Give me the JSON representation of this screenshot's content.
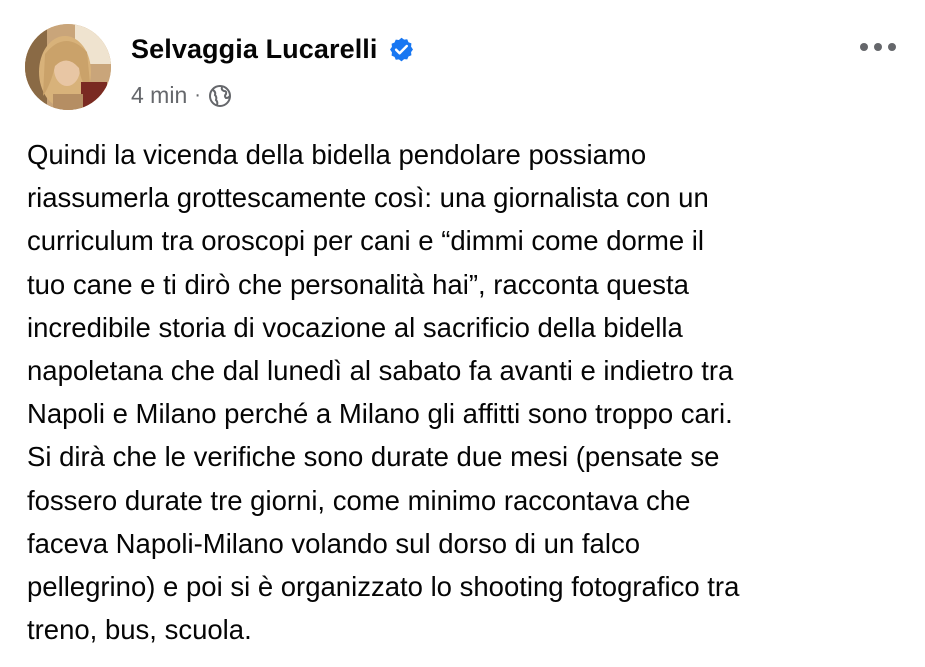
{
  "post": {
    "author_name": "Selvaggia Lucarelli",
    "verified": true,
    "timestamp": "4 min",
    "separator": "·",
    "audience_icon": "globe-icon",
    "more_icon": "more-options-icon",
    "text_lines": [
      "Quindi la vicenda della bidella pendolare possiamo",
      "riassumerla grottescamente così: una giornalista con un",
      "curriculum tra oroscopi per cani e “dimmi come dorme il",
      "tuo cane e ti dirò che personalità hai”, racconta questa",
      "incredibile storia di vocazione al sacrificio della bidella",
      "napoletana che dal lunedì al sabato fa avanti e indietro tra",
      "Napoli e Milano perché a Milano gli affitti sono troppo cari.",
      "Si dirà che le verifiche sono durate due mesi (pensate se",
      "fossero durate tre giorni, come minimo raccontava che",
      "faceva Napoli-Milano volando sul dorso di un falco",
      "pellegrino) e poi si è organizzato lo shooting fotografico tra",
      "treno, bus, scuola."
    ]
  },
  "colors": {
    "verified_badge": "#1877f2",
    "meta_text": "#65676b",
    "body_text": "#050505"
  }
}
